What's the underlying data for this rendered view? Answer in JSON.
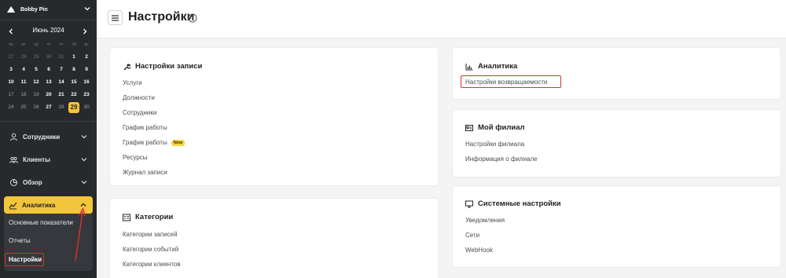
{
  "brand": {
    "name": "Bobby Pin"
  },
  "calendar": {
    "month_label": "Июнь 2024",
    "weekdays": [
      "пн",
      "вт",
      "ср",
      "чт",
      "пт",
      "сб",
      "вс"
    ],
    "weeks": [
      [
        "27",
        "28",
        "29",
        "30",
        "31",
        "1",
        "2"
      ],
      [
        "3",
        "4",
        "5",
        "6",
        "7",
        "8",
        "9"
      ],
      [
        "10",
        "11",
        "12",
        "13",
        "14",
        "15",
        "16"
      ],
      [
        "17",
        "18",
        "19",
        "20",
        "21",
        "22",
        "23"
      ],
      [
        "24",
        "25",
        "26",
        "27",
        "28",
        "29",
        "30"
      ]
    ],
    "today": "29"
  },
  "sidebar": {
    "nav": [
      {
        "label": "Сотрудники",
        "icon": "person-icon"
      },
      {
        "label": "Клиенты",
        "icon": "people-icon"
      },
      {
        "label": "Обзор",
        "icon": "pie-chart-icon"
      }
    ],
    "analytics": {
      "label": "Аналитика",
      "icon": "chart-icon",
      "items": [
        "Основные показатели",
        "Отчеты",
        "Настройки"
      ],
      "active_item": "Настройки"
    },
    "accent_color": "#f3c53a"
  },
  "header": {
    "title": "Настройки"
  },
  "cards": {
    "booking": {
      "title": "Настройки записи",
      "icon": "wrench-icon",
      "links": [
        "Услуги",
        "Должности",
        "Сотрудники",
        "График работы",
        "График работы",
        "Ресурсы",
        "Журнал записи"
      ],
      "new_badge": "New"
    },
    "categories": {
      "title": "Категории",
      "icon": "category-icon",
      "links": [
        "Категории записей",
        "Категории событий",
        "Категории клиентов"
      ]
    },
    "analytics": {
      "title": "Аналитика",
      "icon": "bar-chart-icon",
      "links": [
        "Настройки возвращаемости"
      ]
    },
    "branch": {
      "title": "Мой филиал",
      "icon": "id-card-icon",
      "links": [
        "Настройки филиала",
        "Информация о филиале"
      ]
    },
    "system": {
      "title": "Системные настройки",
      "icon": "monitor-icon",
      "links": [
        "Уведомления",
        "Сети",
        "WebHook"
      ]
    }
  },
  "highlight_color": "#d7302c"
}
